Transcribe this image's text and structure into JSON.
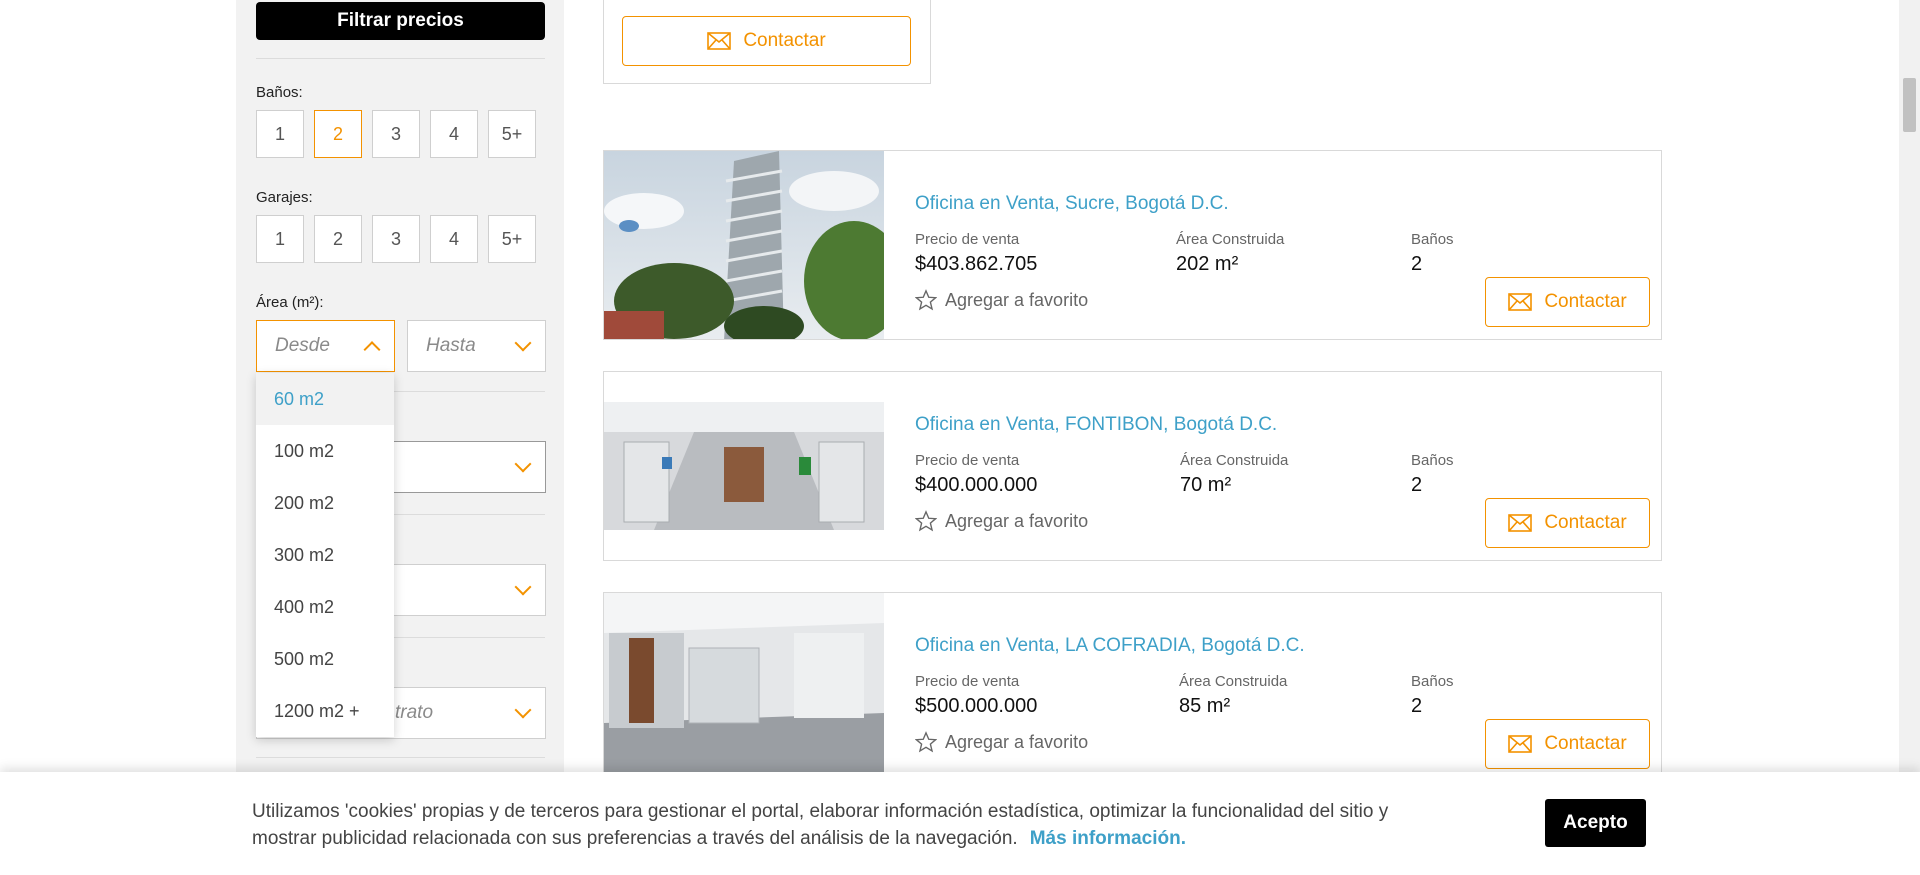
{
  "filters": {
    "filter_button": "Filtrar precios",
    "banos_label": "Baños:",
    "banos_options": [
      "1",
      "2",
      "3",
      "4",
      "5+"
    ],
    "banos_selected": "2",
    "garajes_label": "Garajes:",
    "garajes_options": [
      "1",
      "2",
      "3",
      "4",
      "5+"
    ],
    "area_label": "Área (m²):",
    "area_from_placeholder": "Desde",
    "area_to_placeholder": "Hasta",
    "area_dropdown": [
      "60 m2",
      "100 m2",
      "200 m2",
      "300 m2",
      "400 m2",
      "500 m2",
      "1200 m2 +"
    ],
    "area_dropdown_highlighted": "60 m2",
    "partial_select_text": "trato"
  },
  "top_card": {
    "contact_label": "Contactar"
  },
  "listings": [
    {
      "title": "Oficina en Venta, Sucre, Bogotá D.C.",
      "price_label": "Precio de venta",
      "price": "$403.862.705",
      "area_label": "Área Construida",
      "area": "202 m²",
      "banos_label": "Baños",
      "banos": "2",
      "favorite": "Agregar a favorito",
      "contact": "Contactar"
    },
    {
      "title": "Oficina en Venta, FONTIBON, Bogotá D.C.",
      "price_label": "Precio de venta",
      "price": "$400.000.000",
      "area_label": "Área Construida",
      "area": "70 m²",
      "banos_label": "Baños",
      "banos": "2",
      "favorite": "Agregar a favorito",
      "contact": "Contactar"
    },
    {
      "title": "Oficina en Venta, LA COFRADIA, Bogotá D.C.",
      "price_label": "Precio de venta",
      "price": "$500.000.000",
      "area_label": "Área Construida",
      "area": "85 m²",
      "banos_label": "Baños",
      "banos": "2",
      "favorite": "Agregar a favorito",
      "contact": "Contactar"
    }
  ],
  "cookie": {
    "text": "Utilizamos 'cookies' propias y de terceros para gestionar el portal, elaborar información estadística, optimizar la funcionalidad del sitio y mostrar publicidad relacionada con sus preferencias a través del análisis de la navegación.",
    "more_link": "Más información.",
    "accept": "Acepto"
  },
  "colors": {
    "accent": "#f39200",
    "link": "#3ea0c8",
    "dark": "#000000"
  }
}
